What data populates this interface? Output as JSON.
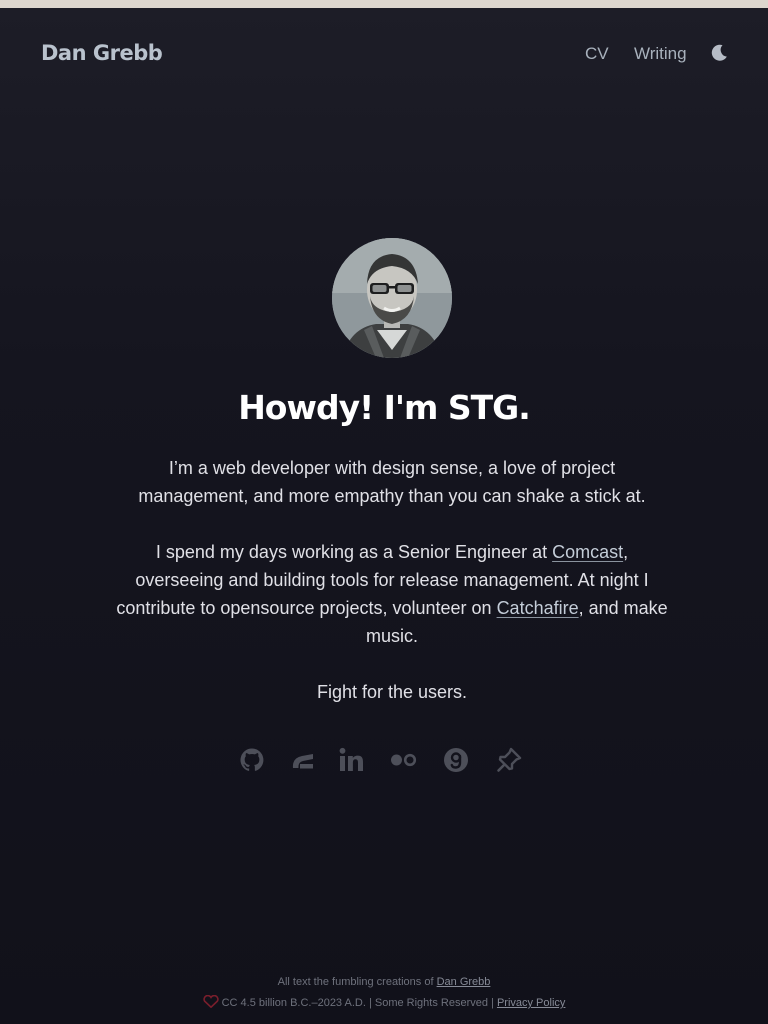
{
  "header": {
    "brand": "Dan Grebb",
    "nav": [
      {
        "label": "CV"
      },
      {
        "label": "Writing"
      }
    ],
    "theme_icon": "moon-icon"
  },
  "hero": {
    "avatar_icon": "avatar-photo",
    "headline": "Howdy! I'm STG.",
    "bio_1": "I’m a web developer with design sense, a love of project management, and more empathy than you can shake a stick at.",
    "bio_2": {
      "before_link_1": "I spend my days working as a Senior Engineer at ",
      "link_1": "Comcast",
      "between": ", overseeing and building tools for release management. At night I contribute to opensource projects, volunteer on ",
      "link_2": "Catchafire",
      "after": ", and make music."
    },
    "bio_3": "Fight for the users."
  },
  "socials": [
    {
      "icon": "github-icon"
    },
    {
      "icon": "stack-icon"
    },
    {
      "icon": "linkedin-icon"
    },
    {
      "icon": "flickr-icon"
    },
    {
      "icon": "goodreads-icon"
    },
    {
      "icon": "pinboard-icon"
    }
  ],
  "footer": {
    "line1_prefix": "All text the fumbling creations of ",
    "line1_link": "Dan Grebb",
    "line2_text": "CC 4.5 billion B.C.–2023 A.D. | Some Rights Reserved | ",
    "line2_link": "Privacy Policy",
    "heart_icon": "heart-icon"
  },
  "colors": {
    "background": "#13131c",
    "headline": "#ffffff",
    "brand": "#b9c2cd",
    "icon": "#4d4f59"
  }
}
